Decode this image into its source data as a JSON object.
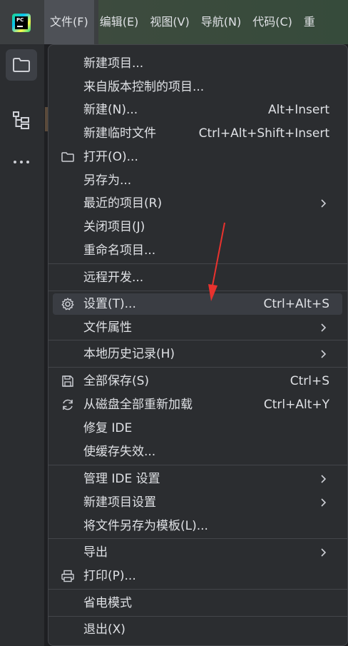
{
  "app": {
    "logo_text": "PC"
  },
  "menubar": [
    {
      "key": "file",
      "label": "文件(F)",
      "active": true
    },
    {
      "key": "edit",
      "label": "编辑(E)",
      "active": false
    },
    {
      "key": "view",
      "label": "视图(V)",
      "active": false
    },
    {
      "key": "navigate",
      "label": "导航(N)",
      "active": false
    },
    {
      "key": "code",
      "label": "代码(C)",
      "active": false
    },
    {
      "key": "refactor",
      "label": "重",
      "active": false
    }
  ],
  "sidebar": [
    {
      "key": "project",
      "icon": "folder-icon"
    },
    {
      "key": "structure",
      "icon": "structure-icon"
    },
    {
      "key": "more",
      "icon": "more-icon"
    }
  ],
  "file_menu": {
    "items": [
      {
        "key": "new-project",
        "label": "新建项目..."
      },
      {
        "key": "project-from-vcs",
        "label": "来自版本控制的项目..."
      },
      {
        "key": "new",
        "label": "新建(N)...",
        "shortcut": "Alt+Insert"
      },
      {
        "key": "new-scratch-file",
        "label": "新建临时文件",
        "shortcut": "Ctrl+Alt+Shift+Insert"
      },
      {
        "key": "open",
        "label": "打开(O)...",
        "icon": "folder-icon"
      },
      {
        "key": "save-as",
        "label": "另存为..."
      },
      {
        "key": "recent-projects",
        "label": "最近的项目(R)",
        "submenu": true
      },
      {
        "key": "close-project",
        "label": "关闭项目(J)"
      },
      {
        "key": "rename-project",
        "label": "重命名项目..."
      },
      {
        "key": "remote-dev",
        "label": "远程开发..."
      },
      {
        "key": "settings",
        "label": "设置(T)...",
        "shortcut": "Ctrl+Alt+S",
        "icon": "gear-icon",
        "highlighted": true
      },
      {
        "key": "file-properties",
        "label": "文件属性",
        "submenu": true
      },
      {
        "key": "local-history",
        "label": "本地历史记录(H)",
        "submenu": true
      },
      {
        "key": "save-all",
        "label": "全部保存(S)",
        "shortcut": "Ctrl+S",
        "icon": "save-icon"
      },
      {
        "key": "reload-all",
        "label": "从磁盘全部重新加载",
        "shortcut": "Ctrl+Alt+Y",
        "icon": "reload-icon"
      },
      {
        "key": "repair-ide",
        "label": "修复 IDE"
      },
      {
        "key": "invalidate-caches",
        "label": "使缓存失效..."
      },
      {
        "key": "manage-ide-settings",
        "label": "管理 IDE 设置",
        "submenu": true
      },
      {
        "key": "new-project-settings",
        "label": "新建项目设置",
        "submenu": true
      },
      {
        "key": "save-as-template",
        "label": "将文件另存为模板(L)..."
      },
      {
        "key": "export",
        "label": "导出",
        "submenu": true
      },
      {
        "key": "print",
        "label": "打印(P)...",
        "icon": "print-icon"
      },
      {
        "key": "power-save",
        "label": "省电模式"
      },
      {
        "key": "exit",
        "label": "退出(X)"
      }
    ]
  },
  "colors": {
    "annotation_arrow": "#e8322e",
    "highlight": "#3a3d43",
    "menu_bg": "#2b2d30"
  }
}
